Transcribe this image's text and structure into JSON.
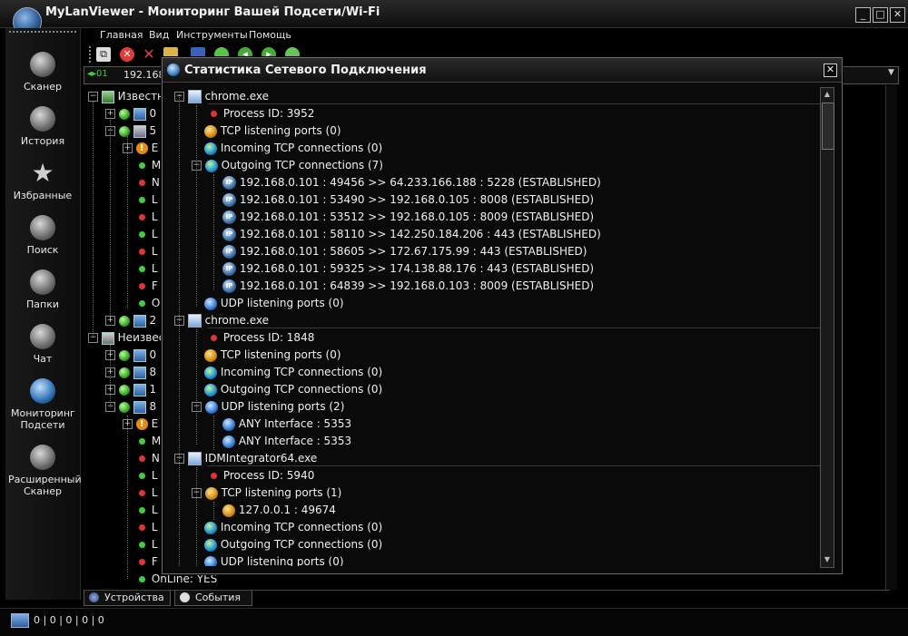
{
  "app": {
    "title": "MyLanViewer - Мониторинг Вашей Подсети/Wi-Fi",
    "window_buttons": [
      "_",
      "□",
      "✕"
    ]
  },
  "menu": [
    "Главная",
    "Вид",
    "Инструменты",
    "Помощь"
  ],
  "sidebar": [
    {
      "label": "Сканер",
      "icon": "scanner-icon"
    },
    {
      "label": "История",
      "icon": "history-icon"
    },
    {
      "label": "Избранные",
      "icon": "star-icon"
    },
    {
      "label": "Поиск",
      "icon": "search-icon"
    },
    {
      "label": "Папки",
      "icon": "folders-icon"
    },
    {
      "label": "Чат",
      "icon": "chat-icon"
    },
    {
      "label": "Мониторинг Подсети",
      "icon": "subnet-monitor-icon"
    },
    {
      "label": "Расширенный Сканер",
      "icon": "advanced-scanner-icon"
    }
  ],
  "address": {
    "nav": "◂▸01",
    "text": "192.168"
  },
  "bg_tree": {
    "known_group": "Известн",
    "unknown_group": "Неизвес",
    "online_label": "OnLine: YES",
    "row_prefixes": [
      "0",
      "5",
      "E",
      "M",
      "N",
      "L",
      "L",
      "L",
      "L",
      "L",
      "F",
      "O",
      "2",
      "0",
      "8",
      "1",
      "8",
      "E",
      "M",
      "N",
      "L",
      "L",
      "L",
      "L",
      "L",
      "F"
    ]
  },
  "dialog": {
    "title": "Статистика Сетевого Подключения",
    "close_label": "✕",
    "processes": [
      {
        "name": "chrome.exe",
        "pid": "Process ID: 3952",
        "tcp_listen": "TCP listening ports (0)",
        "incoming": "Incoming TCP connections (0)",
        "outgoing": "Outgoing TCP connections (7)",
        "connections": [
          "192.168.0.101 : 49456  >>  64.233.166.188 : 5228  (ESTABLISHED)",
          "192.168.0.101 : 53490  >>  192.168.0.105 : 8008  (ESTABLISHED)",
          "192.168.0.101 : 53512  >>  192.168.0.105 : 8009  (ESTABLISHED)",
          "192.168.0.101 : 58110  >>  142.250.184.206 : 443  (ESTABLISHED)",
          "192.168.0.101 : 58605  >>  172.67.175.99 : 443  (ESTABLISHED)",
          "192.168.0.101 : 59325  >>  174.138.88.176 : 443  (ESTABLISHED)",
          "192.168.0.101 : 64839  >>  192.168.0.103 : 8009  (ESTABLISHED)"
        ],
        "udp_listen": "UDP listening ports (0)"
      },
      {
        "name": "chrome.exe",
        "pid": "Process ID: 1848",
        "tcp_listen": "TCP listening ports (0)",
        "incoming": "Incoming TCP connections (0)",
        "outgoing": "Outgoing TCP connections (0)",
        "udp_listen": "UDP listening ports (2)",
        "udp_ports": [
          "ANY Interface : 5353",
          "ANY Interface : 5353"
        ]
      },
      {
        "name": "IDMIntegrator64.exe",
        "pid": "Process ID: 5940",
        "tcp_listen": "TCP listening ports (1)",
        "tcp_ports": [
          "127.0.0.1 : 49674"
        ],
        "incoming": "Incoming TCP connections (0)",
        "outgoing": "Outgoing TCP connections (0)",
        "udp_listen": "UDP listening ports (0)"
      }
    ]
  },
  "bottom_tabs": [
    "Устройства",
    "События"
  ],
  "status": {
    "text": "0 | 0 | 0 | 0 | 0"
  }
}
